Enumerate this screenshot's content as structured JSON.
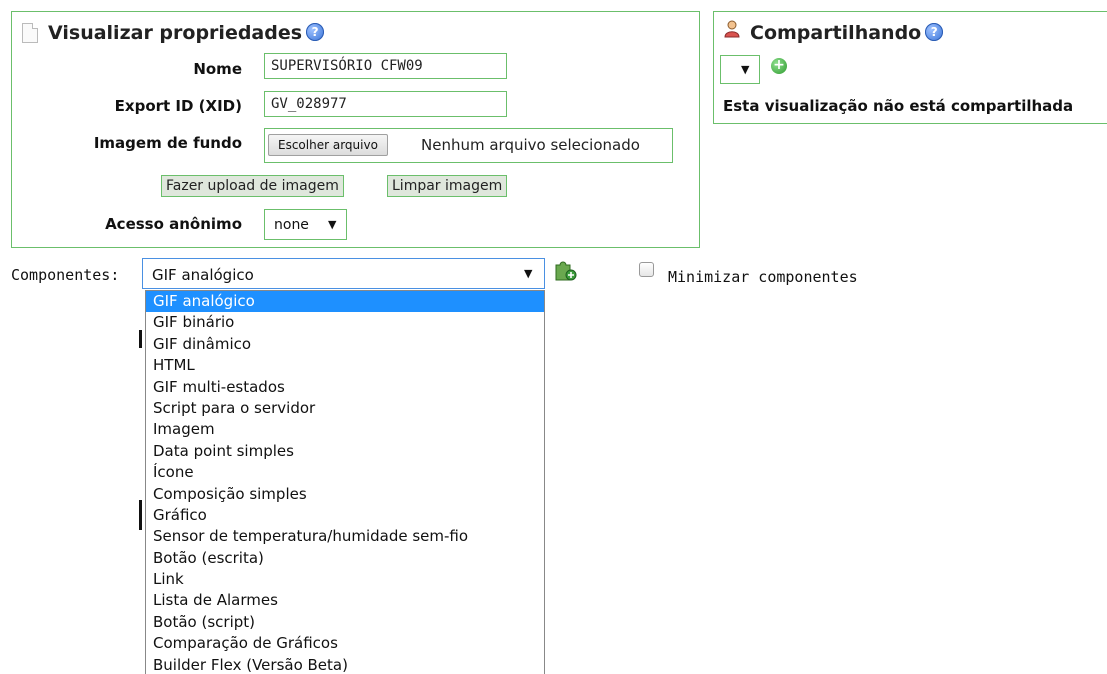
{
  "properties": {
    "title": "Visualizar propriedades",
    "help_icon": "?",
    "name_label": "Nome",
    "name_value": "SUPERVISÓRIO CFW09",
    "xid_label": "Export ID (XID)",
    "xid_value": "GV_028977",
    "bg_label": "Imagem de fundo",
    "choose_file_button": "Escolher arquivo",
    "no_file_text": "Nenhum arquivo selecionado",
    "upload_button": "Fazer upload de imagem",
    "clear_button": "Limpar imagem",
    "anon_label": "Acesso anônimo",
    "anon_value": "none",
    "arrow": "▼"
  },
  "sharing": {
    "title": "Compartilhando",
    "help_icon": "?",
    "arrow": "▼",
    "add_icon": "+",
    "status_text": "Esta visualização não está compartilhada"
  },
  "components": {
    "label": "Componentes:",
    "selected": "GIF analógico",
    "arrow": "▼",
    "minimize_label": "Minimizar componentes",
    "options": [
      "GIF analógico",
      "GIF binário",
      "GIF dinâmico",
      "HTML",
      "GIF multi-estados",
      "Script para o servidor",
      "Imagem",
      "Data point simples",
      "Ícone",
      "Composição simples",
      "Gráfico",
      "Sensor de temperatura/humidade sem-fio",
      "Botão (escrita)",
      "Link",
      "Lista de Alarmes",
      "Botão (script)",
      "Comparação de Gráficos",
      "Builder Flex (Versão Beta)"
    ]
  },
  "colors": {
    "panel_border": "#6bbf6b",
    "selection": "#1e90ff",
    "button_bg": "#dfe7dc"
  }
}
